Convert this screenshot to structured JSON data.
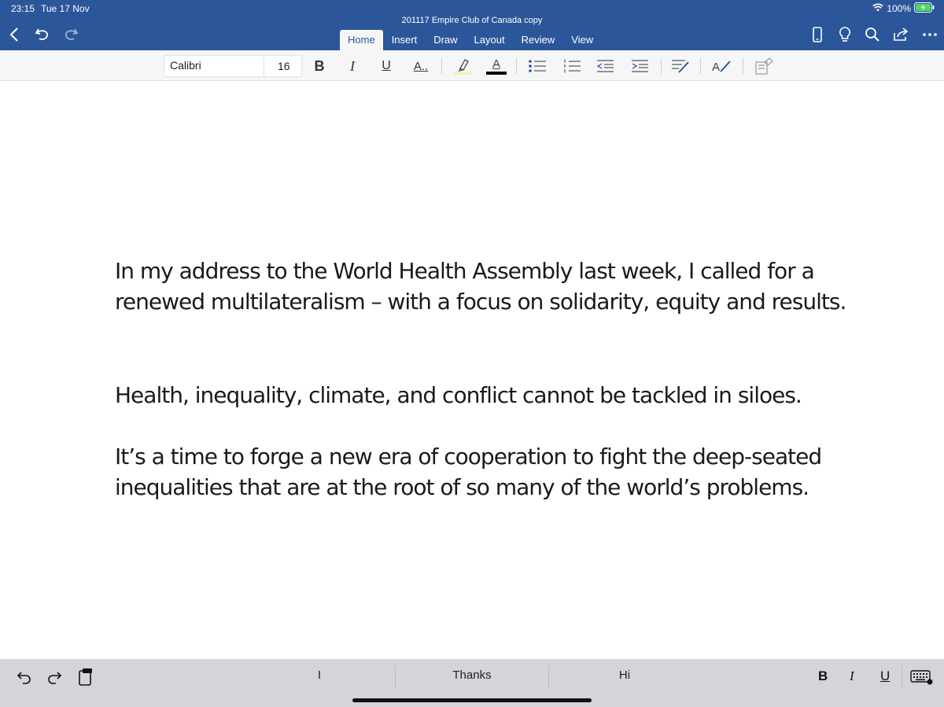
{
  "status": {
    "time": "23:15",
    "date": "Tue 17 Nov",
    "battery": "100%"
  },
  "document_title": "201117 Empire Club of Canada copy",
  "tabs": [
    "Home",
    "Insert",
    "Draw",
    "Layout",
    "Review",
    "View"
  ],
  "active_tab": "Home",
  "ribbon": {
    "font_name": "Calibri",
    "font_size": "16",
    "bold": "B",
    "italic": "I",
    "underline": "U",
    "more_format": "A..",
    "font_color_letter": "A"
  },
  "paragraphs": [
    "In my address to the World Health Assembly last week, I called for a renewed multilateralism – with a focus on solidarity, equity and results.",
    "Health, inequality, climate, and conflict cannot be tackled in siloes.",
    "It’s a time to forge a new era of cooperation to fight the deep-seated inequalities that are at the root of so many of the world’s problems."
  ],
  "keyboard_bar": {
    "suggestions": [
      "I",
      "Thanks",
      "Hi"
    ],
    "bold": "B",
    "italic": "I",
    "underline": "U"
  },
  "colors": {
    "header": "#2b579a",
    "ribbon": "#f6f6f6",
    "keyboard_bar": "#d3d5db"
  },
  "icons": [
    "back-icon",
    "undo-icon",
    "redo-icon",
    "wifi-icon",
    "battery-icon",
    "phone-view-icon",
    "lightbulb-icon",
    "search-icon",
    "share-icon",
    "more-icon",
    "highlighter-icon",
    "bullets-icon",
    "numbering-icon",
    "decrease-indent-icon",
    "increase-indent-icon",
    "styles-icon",
    "format-painter-icon",
    "clear-formatting-icon",
    "keyboard-icon",
    "paste-icon"
  ]
}
